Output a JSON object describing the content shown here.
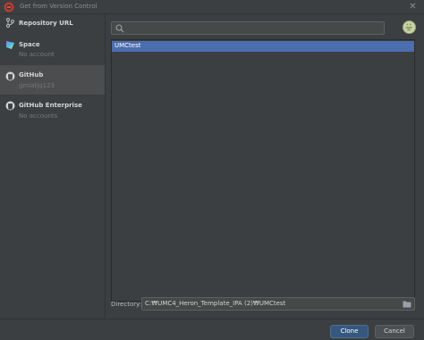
{
  "window": {
    "title": "Get from Version Control"
  },
  "sidebar": {
    "items": [
      {
        "label": "Repository URL",
        "sub": ""
      },
      {
        "label": "Space",
        "sub": "No account"
      },
      {
        "label": "GitHub",
        "sub": "gmlatjq123"
      },
      {
        "label": "GitHub Enterprise",
        "sub": "No accounts"
      }
    ]
  },
  "main": {
    "search": {
      "value": "",
      "placeholder": ""
    },
    "repos": [
      {
        "name": "UMCtest",
        "selected": true
      }
    ],
    "directory": {
      "label": "Directory:",
      "value": "C:₩UMC4_Heron_Template_IPA (2)₩UMCtest"
    }
  },
  "buttons": {
    "clone": "Clone",
    "cancel": "Cancel"
  },
  "colors": {
    "accent": "#4b6eaf",
    "clone_button": "#365880",
    "background": "#3c3f41",
    "selected_item": "#4b4d4f"
  }
}
